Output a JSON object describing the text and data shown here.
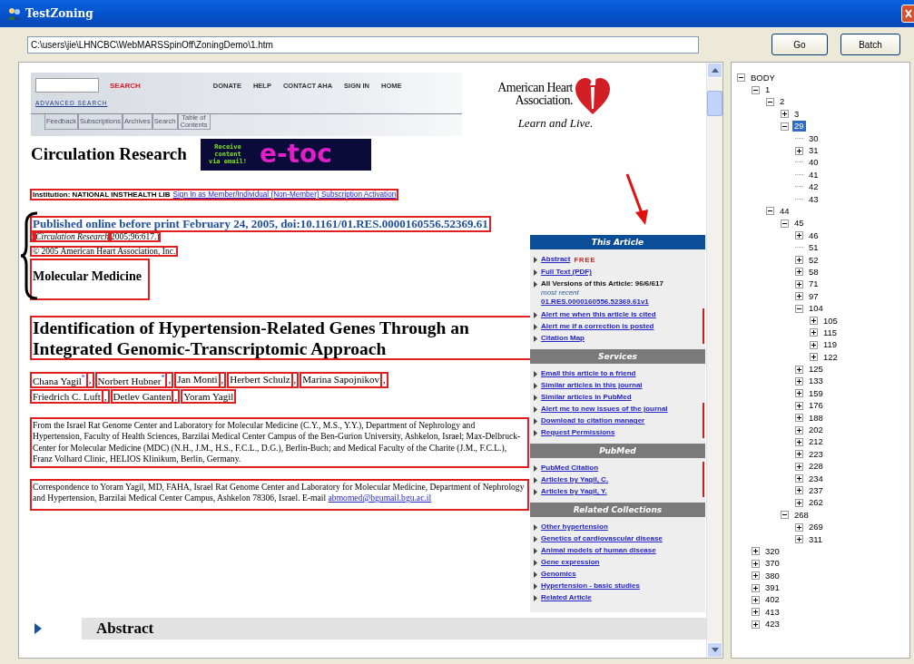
{
  "window": {
    "title": "TestZoning"
  },
  "toolbar": {
    "path": "C:\\users\\jie\\LHNCBC\\WebMARSSpinOff\\ZoningDemo\\1.htm",
    "buttons": [
      "Go",
      "Batch"
    ]
  },
  "page": {
    "header": {
      "search_button": "SEARCH",
      "advanced_search": "ADVANCED SEARCH",
      "nav_links": [
        "DONATE",
        "HELP",
        "CONTACT AHA",
        "SIGN IN",
        "HOME"
      ],
      "tabs": [
        "Feedback",
        "Subscriptions",
        "Archives",
        "Search",
        "Table of Contents"
      ],
      "logo_name": "American Heart Association.",
      "logo_tagline": "Learn and Live."
    },
    "journal_title": "Circulation Research",
    "etoc": {
      "text": "Receive content via email!",
      "logo": "e-toc"
    },
    "institution": {
      "label": "Institution: NATIONAL INSTHEALTH LIB",
      "link": "Sign In as Member/Individual (Non-Member) Subscription Activation"
    },
    "published": "Published online before print February 24, 2005, doi:10.1161/01.RES.0000160556.52369.61",
    "citation": {
      "open": "(",
      "journal": "Circulation Research",
      "ref": "2005;96:617.)"
    },
    "copyright": "© 2005 American Heart Association, Inc.",
    "section": "Molecular Medicine",
    "title": "Identification of Hypertension-Related Genes Through an Integrated Genomic-Transcriptomic Approach",
    "authors": [
      {
        "name": "Chana Yagil",
        "mark": "*",
        "sep": ","
      },
      {
        "name": "Norbert Hubner",
        "mark": "*",
        "sep": ","
      },
      {
        "name": "Jan Monti",
        "sep": ","
      },
      {
        "name": "Herbert Schulz",
        "sep": ","
      },
      {
        "name": "Marina Sapojnikov",
        "sep": ","
      },
      {
        "name": "Friedrich C. Luft",
        "sep": ","
      },
      {
        "name": "Detlev Ganten",
        "sep": ","
      },
      {
        "name": "Yoram Yagil"
      }
    ],
    "affiliation": "From the Israel Rat Genome Center and Laboratory for Molecular Medicine (C.Y., M.S., Y.Y.), Department of Nephrology and Hypertension, Faculty of Health Sciences, Barzilai Medical Center Campus of the Ben-Gurion University, Ashkelon, Israel; Max-Delbruck-Center for Molecular Medicine (MDC) (N.H., J.M., H.S., F.C.L., D.G.), Berlin-Buch; and Medical Faculty of the Charite (J.M., F.C.L.), Franz Volhard Clinic, HELIOS Klinikum, Berlin, Germany.",
    "correspondence": {
      "text": "Correspondence to Yoram Yagil, MD, FAHA, Israel Rat Genome Center and Laboratory for Molecular Medicine, Department of Nephrology and Hypertension, Barzilai Medical Center Campus, Ashkelon 78306, Israel. E-mail",
      "email": "abmomed@bgumail.bgu.ac.il"
    },
    "abstract_heading": "Abstract"
  },
  "sidebar": {
    "sections": [
      {
        "title": "This Article",
        "color": "#0b4d97",
        "items": [
          {
            "kind": "link",
            "text": "Abstract",
            "badge": "FREE",
            "zoned": false
          },
          {
            "kind": "link",
            "text": "Full Text (PDF)",
            "zoned": false
          },
          {
            "kind": "versions",
            "text": "All Versions of this Article:",
            "volume": "96/6/617",
            "note": "most recent",
            "link": "01.RES.0000160556.52369.61v1",
            "zoned": false
          },
          {
            "kind": "link",
            "text": "Alert me when this article is cited",
            "zoned": true
          },
          {
            "kind": "link",
            "text": "Alert me if a correction is posted",
            "zoned": true
          },
          {
            "kind": "link",
            "text": "Citation Map",
            "zoned": true
          }
        ]
      },
      {
        "title": "Services",
        "color": "#7a7a7a",
        "items": [
          {
            "kind": "link",
            "text": "Email this article to a friend",
            "zoned": false
          },
          {
            "kind": "link",
            "text": "Similar articles in this journal",
            "zoned": false
          },
          {
            "kind": "link",
            "text": "Similar articles in PubMed",
            "zoned": false
          },
          {
            "kind": "link",
            "text": "Alert me to new issues of the journal",
            "zoned": true
          },
          {
            "kind": "link",
            "text": "Download to citation manager",
            "zoned": true
          },
          {
            "kind": "link",
            "text": "Request Permissions",
            "zoned": true
          }
        ]
      },
      {
        "title": "PubMed",
        "color": "#7a7a7a",
        "items": [
          {
            "kind": "link",
            "text": "PubMed Citation",
            "zoned": true
          },
          {
            "kind": "link",
            "text": "Articles by Yagil, C.",
            "zoned": true
          },
          {
            "kind": "link",
            "text": "Articles by Yagil, Y.",
            "zoned": true
          }
        ]
      },
      {
        "title": "Related Collections",
        "color": "#7a7a7a",
        "items": [
          {
            "kind": "link",
            "text": "Other hypertension",
            "zoned": false
          },
          {
            "kind": "link",
            "text": "Genetics of cardiovascular disease",
            "zoned": false
          },
          {
            "kind": "link",
            "text": "Animal models of human disease",
            "zoned": false
          },
          {
            "kind": "link",
            "text": "Gene expression",
            "zoned": false
          },
          {
            "kind": "link",
            "text": "Genomics",
            "zoned": false
          },
          {
            "kind": "link",
            "text": "Hypertension - basic studies",
            "zoned": false
          },
          {
            "kind": "link",
            "text": "Related Article",
            "zoned": false
          }
        ]
      }
    ]
  },
  "tree": {
    "nodes": [
      {
        "label": "BODY",
        "kind": "branch",
        "expanded": true,
        "selected": false,
        "children": [
          {
            "label": "1",
            "kind": "branch",
            "expanded": true,
            "selected": false,
            "children": [
              {
                "label": "2",
                "kind": "branch",
                "expanded": true,
                "selected": false,
                "children": [
                  {
                    "label": "3",
                    "kind": "branch",
                    "expanded": false,
                    "selected": false
                  },
                  {
                    "label": "29",
                    "kind": "branch",
                    "expanded": true,
                    "selected": true,
                    "children": [
                      {
                        "label": "30",
                        "kind": "leaf",
                        "selected": false
                      },
                      {
                        "label": "31",
                        "kind": "branch",
                        "expanded": false,
                        "selected": false
                      },
                      {
                        "label": "40",
                        "kind": "leaf",
                        "selected": false
                      },
                      {
                        "label": "41",
                        "kind": "leaf",
                        "selected": false
                      },
                      {
                        "label": "42",
                        "kind": "leaf",
                        "selected": false
                      },
                      {
                        "label": "43",
                        "kind": "leaf",
                        "selected": false
                      }
                    ]
                  }
                ]
              },
              {
                "label": "44",
                "kind": "branch",
                "expanded": true,
                "selected": false,
                "children": [
                  {
                    "label": "45",
                    "kind": "branch",
                    "expanded": true,
                    "selected": false,
                    "children": [
                      {
                        "label": "46",
                        "kind": "branch",
                        "expanded": false,
                        "selected": false
                      },
                      {
                        "label": "51",
                        "kind": "leaf",
                        "selected": false
                      },
                      {
                        "label": "52",
                        "kind": "branch",
                        "expanded": false,
                        "selected": false
                      },
                      {
                        "label": "58",
                        "kind": "branch",
                        "expanded": false,
                        "selected": false
                      },
                      {
                        "label": "71",
                        "kind": "branch",
                        "expanded": false,
                        "selected": false
                      },
                      {
                        "label": "97",
                        "kind": "branch",
                        "expanded": false,
                        "selected": false
                      },
                      {
                        "label": "104",
                        "kind": "branch",
                        "expanded": true,
                        "selected": false,
                        "children": [
                          {
                            "label": "105",
                            "kind": "branch",
                            "expanded": false,
                            "selected": false
                          },
                          {
                            "label": "115",
                            "kind": "branch",
                            "expanded": false,
                            "selected": false
                          },
                          {
                            "label": "119",
                            "kind": "branch",
                            "expanded": false,
                            "selected": false
                          },
                          {
                            "label": "122",
                            "kind": "branch",
                            "expanded": false,
                            "selected": false
                          }
                        ]
                      },
                      {
                        "label": "125",
                        "kind": "branch",
                        "expanded": false,
                        "selected": false
                      },
                      {
                        "label": "133",
                        "kind": "branch",
                        "expanded": false,
                        "selected": false
                      },
                      {
                        "label": "159",
                        "kind": "branch",
                        "expanded": false,
                        "selected": false
                      },
                      {
                        "label": "176",
                        "kind": "branch",
                        "expanded": false,
                        "selected": false
                      },
                      {
                        "label": "188",
                        "kind": "branch",
                        "expanded": false,
                        "selected": false
                      },
                      {
                        "label": "202",
                        "kind": "branch",
                        "expanded": false,
                        "selected": false
                      },
                      {
                        "label": "212",
                        "kind": "branch",
                        "expanded": false,
                        "selected": false
                      },
                      {
                        "label": "223",
                        "kind": "branch",
                        "expanded": false,
                        "selected": false
                      },
                      {
                        "label": "228",
                        "kind": "branch",
                        "expanded": false,
                        "selected": false
                      },
                      {
                        "label": "234",
                        "kind": "branch",
                        "expanded": false,
                        "selected": false
                      },
                      {
                        "label": "237",
                        "kind": "branch",
                        "expanded": false,
                        "selected": false
                      },
                      {
                        "label": "262",
                        "kind": "branch",
                        "expanded": false,
                        "selected": false
                      }
                    ]
                  },
                  {
                    "label": "268",
                    "kind": "branch",
                    "expanded": true,
                    "selected": false,
                    "children": [
                      {
                        "label": "269",
                        "kind": "branch",
                        "expanded": false,
                        "selected": false
                      },
                      {
                        "label": "311",
                        "kind": "branch",
                        "expanded": false,
                        "selected": false
                      }
                    ]
                  }
                ]
              }
            ]
          },
          {
            "label": "320",
            "kind": "branch",
            "expanded": false,
            "selected": false
          },
          {
            "label": "370",
            "kind": "branch",
            "expanded": false,
            "selected": false
          },
          {
            "label": "380",
            "kind": "branch",
            "expanded": false,
            "selected": false
          },
          {
            "label": "391",
            "kind": "branch",
            "expanded": false,
            "selected": false
          },
          {
            "label": "402",
            "kind": "branch",
            "expanded": false,
            "selected": false
          },
          {
            "label": "413",
            "kind": "branch",
            "expanded": false,
            "selected": false
          },
          {
            "label": "423",
            "kind": "branch",
            "expanded": false,
            "selected": false
          }
        ]
      }
    ]
  }
}
